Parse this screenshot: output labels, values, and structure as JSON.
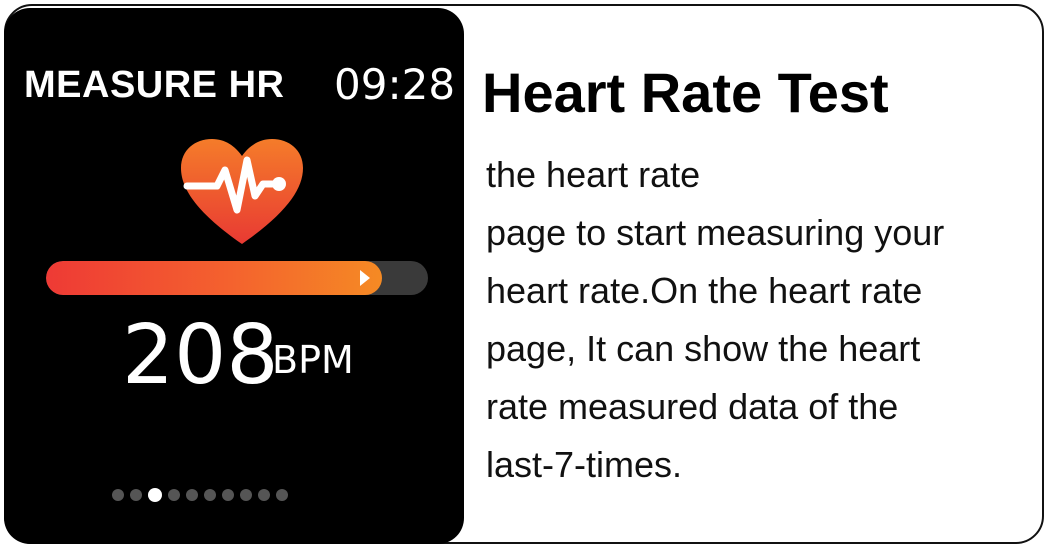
{
  "watch": {
    "title": "MEASURE HR",
    "time": "09:28",
    "heart_rate_value": "208",
    "heart_rate_unit": "BPM",
    "progress_fraction": 0.88,
    "page_count": 10,
    "active_page": 2,
    "colors": {
      "heart_top": "#f57c2a",
      "heart_bottom": "#e83a33",
      "progress_start": "#ee3a35",
      "progress_end": "#f58a24",
      "track": "#3a3a3a"
    }
  },
  "description": {
    "heading": "Heart Rate Test",
    "lines": [
      "the heart rate",
      "page to start measuring your",
      "heart rate.On the heart rate",
      "page, It can show the heart",
      "rate measured data of the",
      "last-7-times."
    ]
  },
  "icons": {
    "heart": "heart-pulse-icon"
  }
}
